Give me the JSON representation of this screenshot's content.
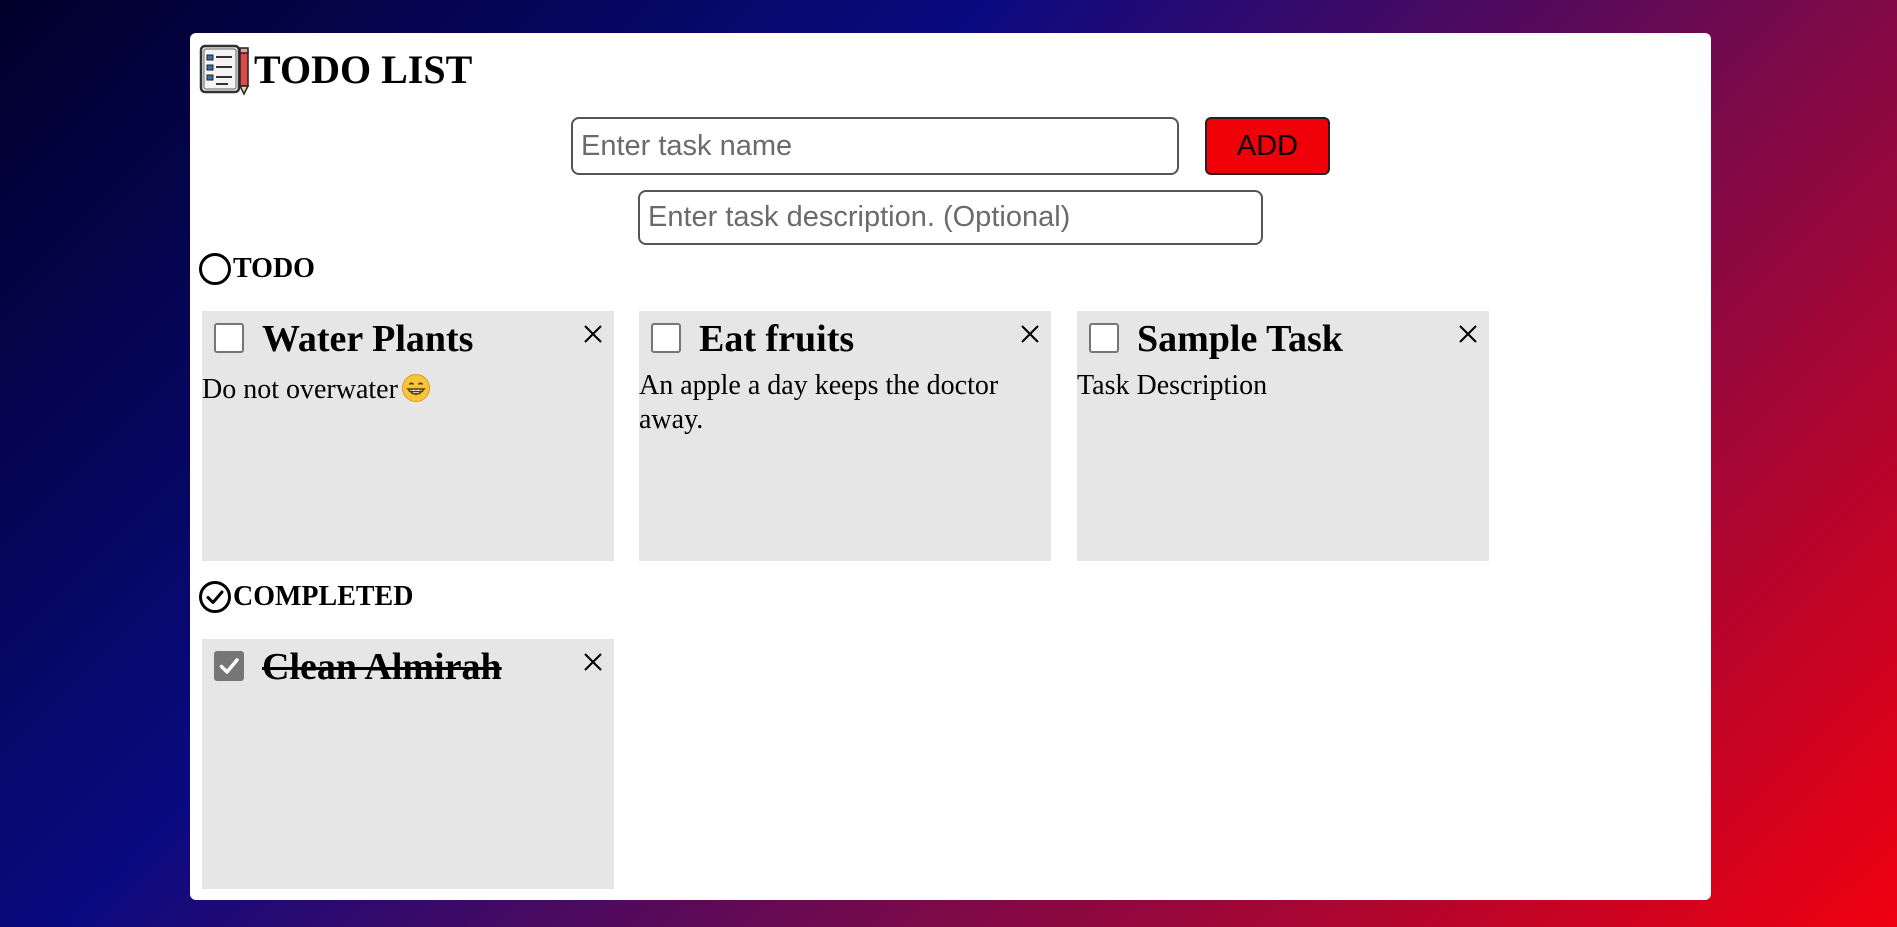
{
  "header": {
    "title": "TODO LIST",
    "logo_icon": "notepad-pencil-icon"
  },
  "form": {
    "task_name_placeholder": "Enter task name",
    "task_name_value": "",
    "add_label": "ADD",
    "task_desc_placeholder": "Enter task description. (Optional)",
    "task_desc_value": ""
  },
  "todo": {
    "heading": "TODO",
    "icon": "circle-icon",
    "tasks": [
      {
        "title": "Water Plants",
        "description": "Do not overwater",
        "emoji": "grinning-face-icon",
        "completed": false
      },
      {
        "title": "Eat fruits",
        "description": "An apple a day keeps the doctor away.",
        "completed": false
      },
      {
        "title": "Sample Task",
        "description": "Task Description",
        "completed": false
      }
    ]
  },
  "completed": {
    "heading": "COMPLETED",
    "icon": "check-circle-icon",
    "tasks": [
      {
        "title": "Clean Almirah",
        "description": "",
        "completed": true
      }
    ]
  },
  "colors": {
    "add_button": "#f00008",
    "card_background": "#e6e6e6",
    "gradient_start": "#00002a",
    "gradient_end": "#f0000f"
  }
}
